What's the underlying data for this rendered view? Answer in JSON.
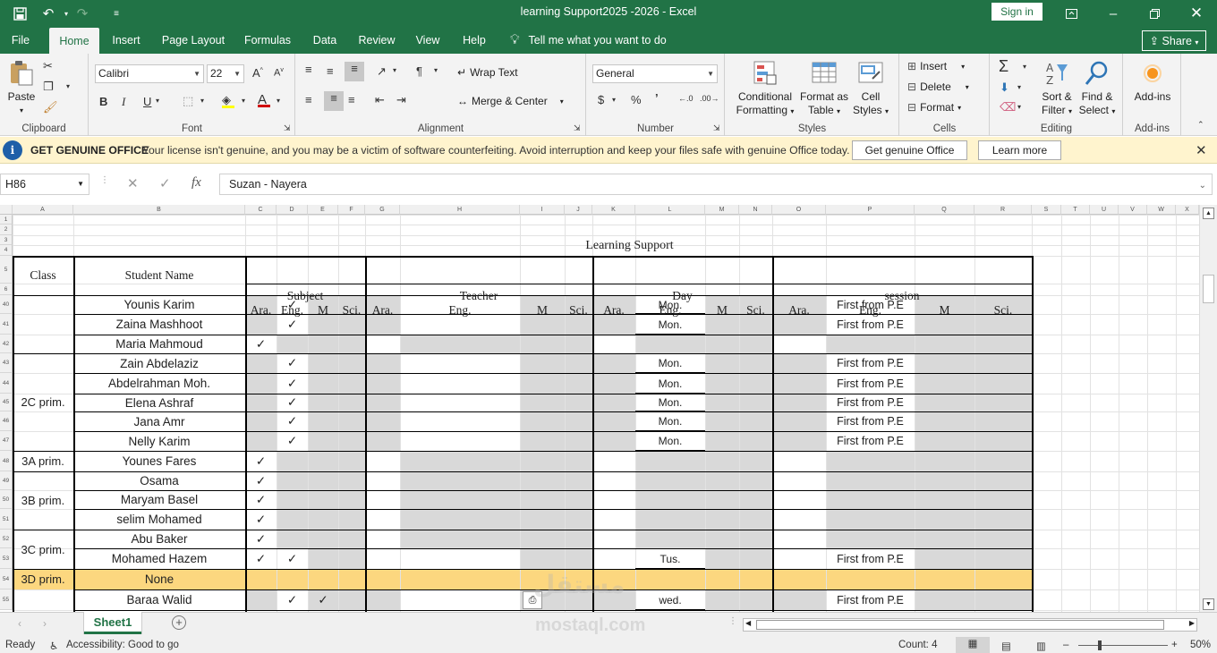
{
  "window": {
    "title": "learning Support2025 -2026  -  Excel",
    "signin": "Sign in"
  },
  "menu": {
    "tabs": [
      "File",
      "Home",
      "Insert",
      "Page Layout",
      "Formulas",
      "Data",
      "Review",
      "View",
      "Help"
    ],
    "active": "Home",
    "tellme": "Tell me what you want to do",
    "share": "Share"
  },
  "ribbon": {
    "clipboard": {
      "label": "Clipboard",
      "paste": "Paste"
    },
    "font": {
      "label": "Font",
      "name": "Calibri",
      "size": "22",
      "bold": "B",
      "italic": "I",
      "underline": "U"
    },
    "alignment": {
      "label": "Alignment",
      "wrap": "Wrap Text",
      "merge": "Merge & Center"
    },
    "number": {
      "label": "Number",
      "format": "General",
      "currency": "$",
      "percent": "%",
      "comma": "’"
    },
    "styles": {
      "label": "Styles",
      "conditional_1": "Conditional",
      "conditional_2": "Formatting",
      "table_1": "Format as",
      "table_2": "Table",
      "cell_1": "Cell",
      "cell_2": "Styles"
    },
    "cells": {
      "label": "Cells",
      "insert": "Insert",
      "delete": "Delete",
      "format": "Format"
    },
    "editing": {
      "label": "Editing",
      "sort_1": "Sort &",
      "sort_2": "Filter",
      "find_1": "Find &",
      "find_2": "Select"
    },
    "addins": {
      "label": "Add-ins",
      "button": "Add-ins"
    }
  },
  "notification": {
    "title": "GET GENUINE OFFICE",
    "message": "Your license isn't genuine, and you may be a victim of software counterfeiting. Avoid interruption and keep your files safe with genuine Office today.",
    "primary": "Get genuine Office",
    "secondary": "Learn more"
  },
  "formula_bar": {
    "namebox": "H86",
    "content": "Suzan - Nayera",
    "fx": "fx"
  },
  "sheet": {
    "columns": [
      "A",
      "B",
      "C",
      "D",
      "E",
      "F",
      "G",
      "H",
      "I",
      "J",
      "K",
      "L",
      "M",
      "N",
      "O",
      "P",
      "Q",
      "R",
      "S",
      "T",
      "U",
      "V",
      "W",
      "X"
    ],
    "row_numbers": [
      "1",
      "2",
      "3",
      "4",
      "5",
      "6",
      "40",
      "41",
      "42",
      "43",
      "44",
      "45",
      "46",
      "47",
      "48",
      "49",
      "50",
      "51",
      "52",
      "53",
      "54",
      "55"
    ],
    "title": "Learning Support",
    "headers": {
      "class": "Class",
      "student": "Student Name",
      "subject": "Subject",
      "teacher": "Teacher",
      "day": "Day",
      "session": "session",
      "sub": [
        "Ara.",
        "Eng.",
        "M",
        "Sci."
      ]
    },
    "check": "✓",
    "class_labels": [
      {
        "label": "2C prim.",
        "from": 3,
        "to": 7
      },
      {
        "label": "3A prim.",
        "from": 8,
        "to": 8
      },
      {
        "label": "3B prim.",
        "from": 9,
        "to": 11
      },
      {
        "label": "3C prim.",
        "from": 12,
        "to": 13
      },
      {
        "label": "3D prim.",
        "from": 14,
        "to": 14
      }
    ],
    "rows": [
      {
        "name": "Younis Karim",
        "ara": false,
        "eng": true,
        "m": false,
        "day": "Mon.",
        "session": "First  from P.E"
      },
      {
        "name": "Zaina Mashhoot",
        "ara": false,
        "eng": true,
        "m": false,
        "day": "Mon.",
        "session": "First  from P.E"
      },
      {
        "name": "Maria Mahmoud",
        "ara": true,
        "eng": false,
        "m": false,
        "day": "",
        "session": ""
      },
      {
        "name": "Zain Abdelaziz",
        "ara": false,
        "eng": true,
        "m": false,
        "day": "Mon.",
        "session": "First  from P.E"
      },
      {
        "name": "Abdelrahman Moh.",
        "ara": false,
        "eng": true,
        "m": false,
        "day": "Mon.",
        "session": "First  from P.E"
      },
      {
        "name": "Elena Ashraf",
        "ara": false,
        "eng": true,
        "m": false,
        "day": "Mon.",
        "session": "First  from P.E"
      },
      {
        "name": "Jana Amr",
        "ara": false,
        "eng": true,
        "m": false,
        "day": "Mon.",
        "session": "First  from P.E"
      },
      {
        "name": "Nelly Karim",
        "ara": false,
        "eng": true,
        "m": false,
        "day": "Mon.",
        "session": "First  from P.E"
      },
      {
        "name": "Younes Fares",
        "ara": true,
        "eng": false,
        "m": false,
        "day": "",
        "session": ""
      },
      {
        "name": "Osama",
        "ara": true,
        "eng": false,
        "m": false,
        "day": "",
        "session": ""
      },
      {
        "name": "Maryam Basel",
        "ara": true,
        "eng": false,
        "m": false,
        "day": "",
        "session": ""
      },
      {
        "name": "selim Mohamed",
        "ara": true,
        "eng": false,
        "m": false,
        "day": "",
        "session": ""
      },
      {
        "name": "Abu Baker",
        "ara": true,
        "eng": false,
        "m": false,
        "day": "",
        "session": ""
      },
      {
        "name": "Mohamed Hazem",
        "ara": true,
        "eng": true,
        "m": false,
        "day": "Tus.",
        "session": "First  from P.E"
      },
      {
        "name": "None",
        "ara": false,
        "eng": false,
        "m": false,
        "day": "",
        "session": "",
        "highlight": "#fcd77f"
      },
      {
        "name": "Baraa Walid",
        "ara": false,
        "eng": true,
        "m": true,
        "day": "wed.",
        "session": "First  from P.E"
      }
    ]
  },
  "sheet_tabs": {
    "active": "Sheet1"
  },
  "status": {
    "ready": "Ready",
    "accessibility": "Accessibility: Good to go",
    "count": "Count: 4",
    "zoom": "50%"
  },
  "watermark": {
    "arabic": "مستقل",
    "latin": "mostaql.com"
  },
  "colors": {
    "brand": "#217346",
    "notif_bg": "#fff4ce",
    "highlight_row": "#fcd77f",
    "shade": "#d9d9d9"
  }
}
